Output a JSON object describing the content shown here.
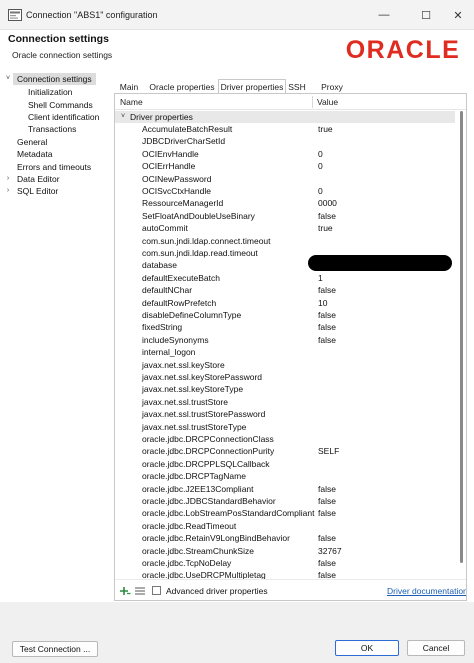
{
  "window": {
    "title": "Connection \"ABS1\" configuration",
    "minimize_glyph": "—",
    "maximize_glyph": "☐",
    "close_glyph": "✕"
  },
  "header": {
    "title": "Connection settings",
    "subtitle": "Oracle connection settings",
    "logo_text": "ORACLE",
    "logo_color": "#e02b20"
  },
  "sidebar": {
    "items": [
      {
        "label": "Connection settings",
        "expanded": true,
        "selected": true
      },
      {
        "label": "Initialization"
      },
      {
        "label": "Shell Commands"
      },
      {
        "label": "Client identification"
      },
      {
        "label": "Transactions"
      },
      {
        "label": "General"
      },
      {
        "label": "Metadata"
      },
      {
        "label": "Errors and timeouts"
      },
      {
        "label": "Data Editor",
        "expandable": true
      },
      {
        "label": "SQL Editor",
        "expandable": true
      }
    ],
    "expanded_glyph": "˅",
    "collapsed_glyph": "›"
  },
  "tabs": [
    {
      "label": "Main"
    },
    {
      "label": "Oracle properties"
    },
    {
      "label": "Driver properties",
      "active": true
    },
    {
      "label": "SSH"
    },
    {
      "label": "Proxy"
    }
  ],
  "table": {
    "col_name": "Name",
    "col_value": "Value",
    "group_label": "Driver properties",
    "group_glyph": "˅",
    "rows": [
      {
        "name": "AccumulateBatchResult",
        "value": "true"
      },
      {
        "name": "JDBCDriverCharSetId",
        "value": ""
      },
      {
        "name": "OCIEnvHandle",
        "value": "0"
      },
      {
        "name": "OCIErrHandle",
        "value": "0"
      },
      {
        "name": "OCINewPassword",
        "value": ""
      },
      {
        "name": "OCISvcCtxHandle",
        "value": "0"
      },
      {
        "name": "RessourceManagerId",
        "value": "0000"
      },
      {
        "name": "SetFloatAndDoubleUseBinary",
        "value": "false"
      },
      {
        "name": "autoCommit",
        "value": "true"
      },
      {
        "name": "com.sun.jndi.ldap.connect.timeout",
        "value": ""
      },
      {
        "name": "com.sun.jndi.ldap.read.timeout",
        "value": ""
      },
      {
        "name": "database",
        "value": ""
      },
      {
        "name": "defaultExecuteBatch",
        "value": "1"
      },
      {
        "name": "defaultNChar",
        "value": "false"
      },
      {
        "name": "defaultRowPrefetch",
        "value": "10"
      },
      {
        "name": "disableDefineColumnType",
        "value": "false"
      },
      {
        "name": "fixedString",
        "value": "false"
      },
      {
        "name": "includeSynonyms",
        "value": "false"
      },
      {
        "name": "internal_logon",
        "value": ""
      },
      {
        "name": "javax.net.ssl.keyStore",
        "value": ""
      },
      {
        "name": "javax.net.ssl.keyStorePassword",
        "value": ""
      },
      {
        "name": "javax.net.ssl.keyStoreType",
        "value": ""
      },
      {
        "name": "javax.net.ssl.trustStore",
        "value": ""
      },
      {
        "name": "javax.net.ssl.trustStorePassword",
        "value": ""
      },
      {
        "name": "javax.net.ssl.trustStoreType",
        "value": ""
      },
      {
        "name": "oracle.jdbc.DRCPConnectionClass",
        "value": ""
      },
      {
        "name": "oracle.jdbc.DRCPConnectionPurity",
        "value": "SELF"
      },
      {
        "name": "oracle.jdbc.DRCPPLSQLCallback",
        "value": ""
      },
      {
        "name": "oracle.jdbc.DRCPTagName",
        "value": ""
      },
      {
        "name": "oracle.jdbc.J2EE13Compliant",
        "value": "false"
      },
      {
        "name": "oracle.jdbc.JDBCStandardBehavior",
        "value": "false"
      },
      {
        "name": "oracle.jdbc.LobStreamPosStandardCompliant",
        "value": "false"
      },
      {
        "name": "oracle.jdbc.ReadTimeout",
        "value": ""
      },
      {
        "name": "oracle.jdbc.RetainV9LongBindBehavior",
        "value": "false"
      },
      {
        "name": "oracle.jdbc.StreamChunkSize",
        "value": "32767"
      },
      {
        "name": "oracle.jdbc.TcpNoDelay",
        "value": "false"
      },
      {
        "name": "oracle.jdbc.UseDRCPMultipletag",
        "value": "false"
      }
    ]
  },
  "table_footer": {
    "advanced_label": "Advanced driver properties",
    "advanced_checked": false,
    "doc_link": "Driver documentation"
  },
  "buttons": {
    "test": "Test Connection ...",
    "ok": "OK",
    "cancel": "Cancel"
  },
  "colors": {
    "accent": "#2d6bd6",
    "link": "#1a5fb4"
  }
}
